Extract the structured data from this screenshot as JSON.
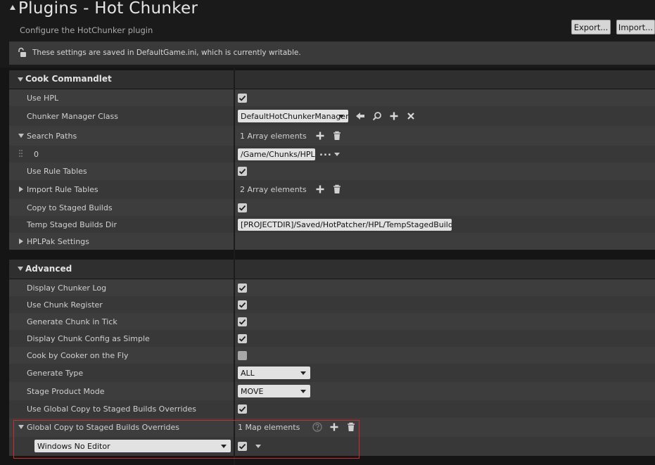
{
  "header": {
    "title": "Plugins - Hot Chunker",
    "subtitle": "Configure the HotChunker plugin",
    "export_label": "Export...",
    "import_label": "Import...",
    "notice": "These settings are saved in DefaultGame.ini, which is currently writable."
  },
  "cook": {
    "title": "Cook Commandlet",
    "use_hpl_label": "Use HPL",
    "use_hpl": true,
    "chunker_manager_label": "Chunker Manager Class",
    "chunker_manager_value": "DefaultHotChunkerManager",
    "search_paths_label": "Search Paths",
    "search_paths_count": "1 Array elements",
    "search_path_index": "0",
    "search_path_value": "/Game/Chunks/HPL",
    "use_rule_tables_label": "Use Rule Tables",
    "use_rule_tables": true,
    "import_rule_tables_label": "Import Rule Tables",
    "import_rule_tables_count": "2 Array elements",
    "copy_staged_label": "Copy to Staged Builds",
    "copy_staged": true,
    "temp_staged_label": "Temp Staged Builds Dir",
    "temp_staged_value": "[PROJECTDIR]/Saved/HotPatcher/HPL/TempStagedBuilds",
    "hplpak_label": "HPLPak Settings"
  },
  "advanced": {
    "title": "Advanced",
    "display_log_label": "Display Chunker Log",
    "display_log": true,
    "chunk_register_label": "Use Chunk Register",
    "chunk_register": true,
    "generate_tick_label": "Generate Chunk in Tick",
    "generate_tick": true,
    "display_simple_label": "Display Chunk Config as Simple",
    "display_simple": true,
    "cook_fly_label": "Cook by Cooker on the Fly",
    "cook_fly": false,
    "generate_type_label": "Generate Type",
    "generate_type_value": "ALL",
    "stage_mode_label": "Stage Product Mode",
    "stage_mode_value": "MOVE",
    "use_global_label": "Use Global Copy to Staged Builds Overrides",
    "use_global": true,
    "global_overrides_label": "Global Copy to Staged Builds Overrides",
    "global_overrides_count": "1 Map elements",
    "map_key_value": "Windows No Editor",
    "map_value": true
  },
  "icons": [
    "lock-icon",
    "arrow-left-icon",
    "browse-icon",
    "plus-icon",
    "close-icon",
    "trash-icon",
    "help-icon",
    "ellipsis-icon",
    "chevron-down-icon",
    "checkmark-icon"
  ],
  "colors": {
    "background": "#151515",
    "row": "#3d3d3d",
    "category": "#2f2f2f",
    "highlight": "#d02a2a",
    "field": "#e2e2e2"
  }
}
